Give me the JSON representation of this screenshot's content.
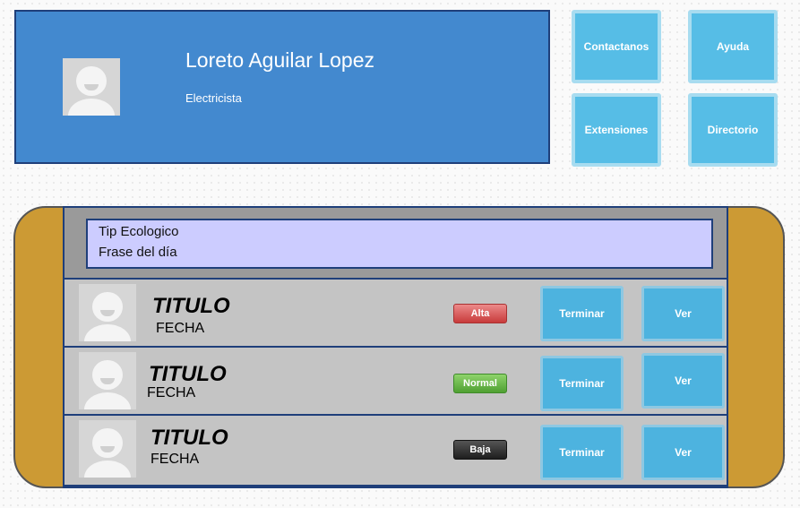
{
  "profile": {
    "name": "Loreto Aguilar Lopez",
    "role": "Electricista"
  },
  "menu": {
    "contact_label": "Contactanos",
    "help_label": "Ayuda",
    "extensions_label": "Extensiones",
    "directory_label": "Directorio"
  },
  "tip": {
    "title": "Tip Ecologico",
    "phrase": "Frase del día"
  },
  "tasks": [
    {
      "title": "TITULO",
      "date": "FECHA",
      "priority": "Alta",
      "finish_label": "Terminar",
      "view_label": "Ver"
    },
    {
      "title": "TITULO",
      "date": "FECHA",
      "priority": "Normal",
      "finish_label": "Terminar",
      "view_label": "Ver"
    },
    {
      "title": "TITULO",
      "date": "FECHA",
      "priority": "Baja",
      "finish_label": "Terminar",
      "view_label": "Ver"
    }
  ],
  "colors": {
    "profile_background": "#4389cf",
    "tile_background": "#56bde6",
    "panel_frame": "#cc9a34",
    "tip_background": "#ccccff",
    "priority_high": "#d9534f",
    "priority_normal": "#5cb85c",
    "priority_low": "#333333"
  },
  "icons": {
    "avatar": "user-avatar-placeholder-icon"
  }
}
